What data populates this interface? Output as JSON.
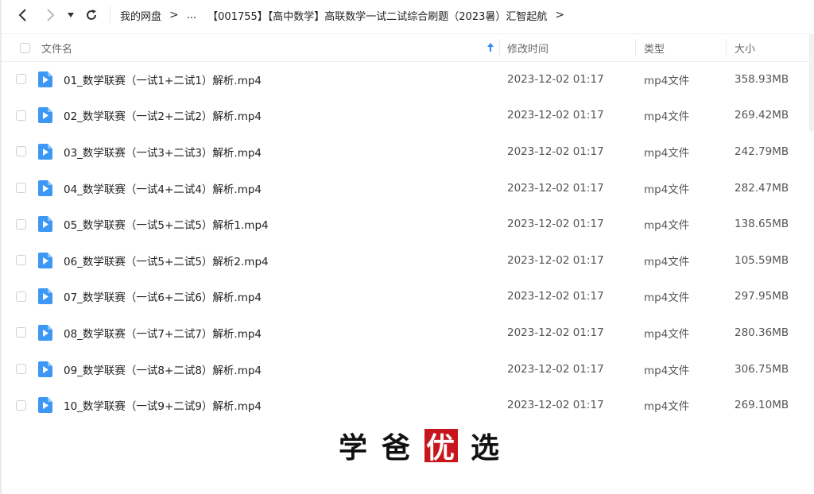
{
  "breadcrumb": {
    "items": [
      "我的网盘",
      "...",
      "【001755】【高中数学】高联数学一试二试综合刷题（2023暑）汇智起航"
    ]
  },
  "header": {
    "name": "文件名",
    "modified": "修改时间",
    "type": "类型",
    "size": "大小"
  },
  "files": [
    {
      "name": "01_数学联赛（一试1+二试1）解析.mp4",
      "date": "2023-12-02 01:17",
      "type": "mp4文件",
      "size": "358.93MB"
    },
    {
      "name": "02_数学联赛（一试2+二试2）解析.mp4",
      "date": "2023-12-02 01:17",
      "type": "mp4文件",
      "size": "269.42MB"
    },
    {
      "name": "03_数学联赛（一试3+二试3）解析.mp4",
      "date": "2023-12-02 01:17",
      "type": "mp4文件",
      "size": "242.79MB"
    },
    {
      "name": "04_数学联赛（一试4+二试4）解析.mp4",
      "date": "2023-12-02 01:17",
      "type": "mp4文件",
      "size": "282.47MB"
    },
    {
      "name": "05_数学联赛（一试5+二试5）解析1.mp4",
      "date": "2023-12-02 01:17",
      "type": "mp4文件",
      "size": "138.65MB"
    },
    {
      "name": "06_数学联赛（一试5+二试5）解析2.mp4",
      "date": "2023-12-02 01:17",
      "type": "mp4文件",
      "size": "105.59MB"
    },
    {
      "name": "07_数学联赛（一试6+二试6）解析.mp4",
      "date": "2023-12-02 01:17",
      "type": "mp4文件",
      "size": "297.95MB"
    },
    {
      "name": "08_数学联赛（一试7+二试7）解析.mp4",
      "date": "2023-12-02 01:17",
      "type": "mp4文件",
      "size": "280.36MB"
    },
    {
      "name": "09_数学联赛（一试8+二试8）解析.mp4",
      "date": "2023-12-02 01:17",
      "type": "mp4文件",
      "size": "306.75MB"
    },
    {
      "name": "10_数学联赛（一试9+二试9）解析.mp4",
      "date": "2023-12-02 01:17",
      "type": "mp4文件",
      "size": "269.10MB"
    }
  ],
  "watermark": {
    "chars": [
      "学",
      "爸",
      "优",
      "选"
    ]
  },
  "colors": {
    "accent": "#2b8af7",
    "file_icon": "#3d97f5",
    "stamp": "#c8161d"
  }
}
